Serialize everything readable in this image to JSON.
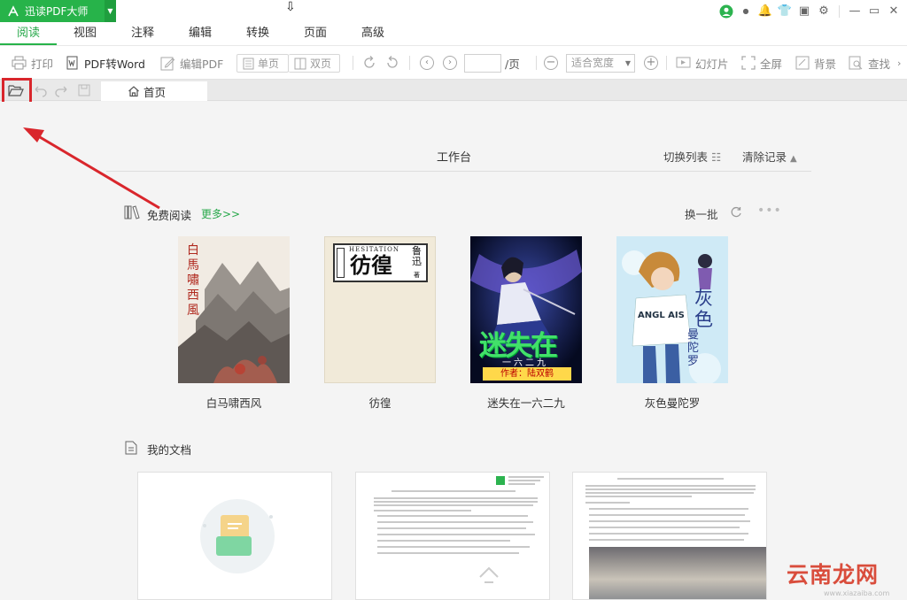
{
  "app": {
    "title": "迅读PDF大师"
  },
  "colors": {
    "brand": "#27b34a",
    "accent_red": "#d9262c",
    "link": "#27a84a"
  },
  "menu": {
    "tabs": [
      {
        "label": "阅读",
        "active": true
      },
      {
        "label": "视图"
      },
      {
        "label": "注释"
      },
      {
        "label": "编辑"
      },
      {
        "label": "转换"
      },
      {
        "label": "页面"
      },
      {
        "label": "高级"
      }
    ]
  },
  "toolbar": {
    "print": "打印",
    "pdf_to_word": "PDF转Word",
    "edit_pdf": "编辑PDF",
    "single_page": "单页",
    "double_page": "双页",
    "page_suffix": "/页",
    "page_value": "",
    "zoom": "适合宽度",
    "slideshow": "幻灯片",
    "fullscreen": "全屏",
    "background": "背景",
    "find": "查找"
  },
  "tabs": {
    "home": "首页"
  },
  "workbench": {
    "title": "工作台",
    "switch_list": "切换列表",
    "clear_records": "清除记录"
  },
  "free_reading": {
    "title": "免费阅读",
    "more": "更多>>",
    "refresh_batch": "换一批",
    "books": [
      {
        "title": "白马啸西风",
        "cover_text": "白馬嘯西風"
      },
      {
        "title": "彷徨",
        "cover_text": "彷徨",
        "cover_en": "HESITATION",
        "author": "鲁迅",
        "author_suffix": "著"
      },
      {
        "title": "迷失在一六二九",
        "cover_text": "迷失在",
        "cover_sub": "一六二九",
        "cover_author": "作者：陆双鹤"
      },
      {
        "title": "灰色曼陀罗",
        "cover_text": "灰色",
        "cover_sub": "曼陀罗",
        "cover_shirt": "ANGL AIS"
      }
    ]
  },
  "my_documents": {
    "title": "我的文档"
  },
  "watermark": {
    "text": "云南龙网",
    "sub": "www.xiazaiba.com"
  }
}
